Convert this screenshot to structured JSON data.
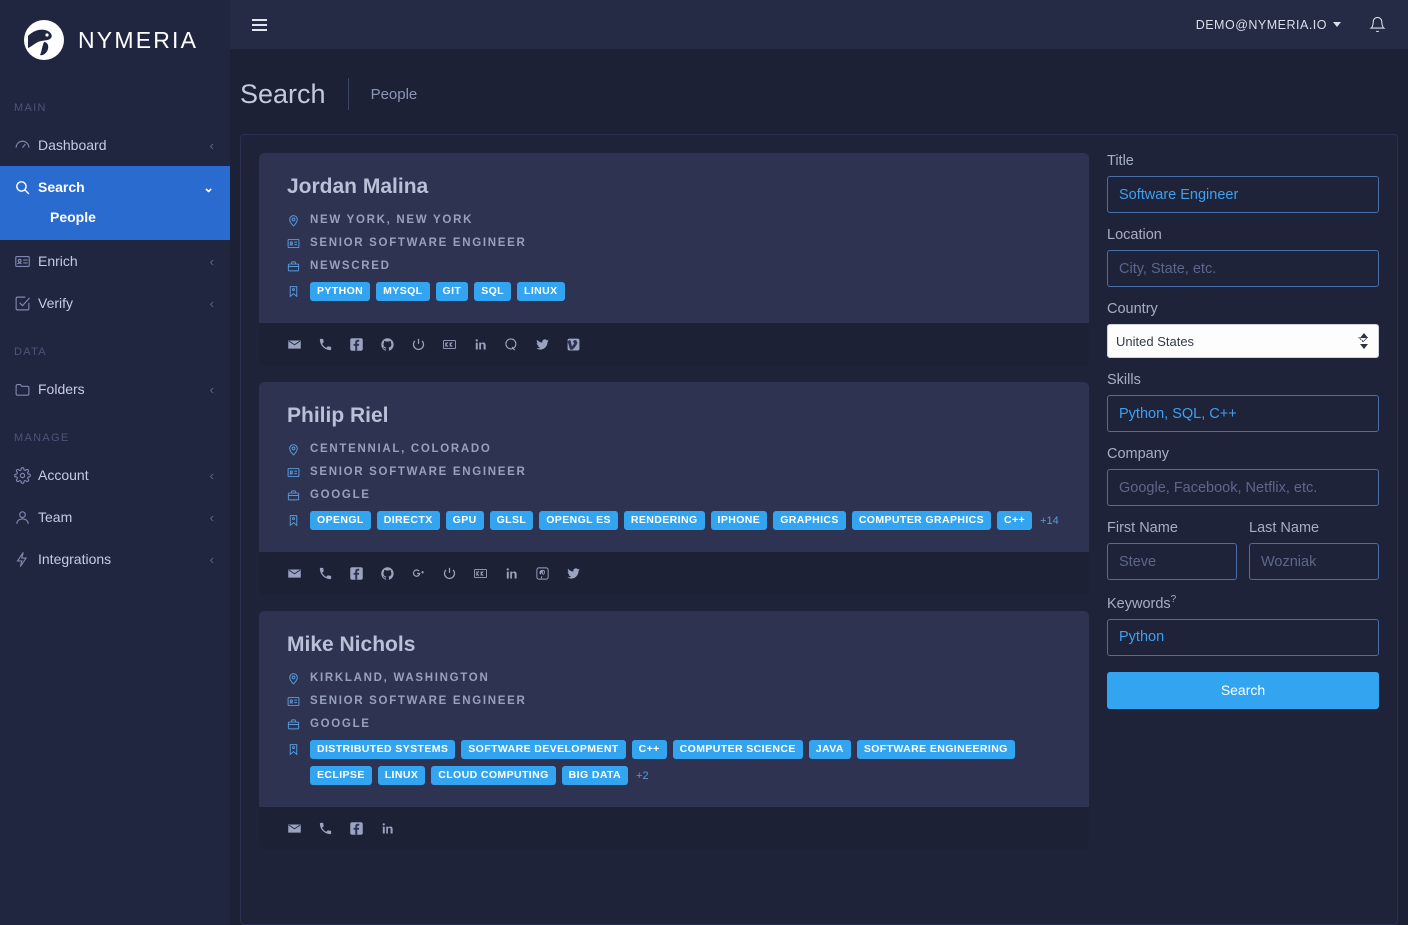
{
  "brand": {
    "name": "NYMERIA"
  },
  "topbar": {
    "user_email": "DEMO@NYMERIA.IO"
  },
  "sidebar": {
    "sections": [
      {
        "label": "MAIN"
      },
      {
        "label": "DATA"
      },
      {
        "label": "MANAGE"
      }
    ],
    "items": [
      {
        "label": "Dashboard",
        "icon": "dashboard-icon",
        "chevron": "‹"
      },
      {
        "label": "Search",
        "icon": "search-icon",
        "chevron": "⌄",
        "active": true,
        "sub": [
          {
            "label": "People"
          }
        ]
      },
      {
        "label": "Enrich",
        "icon": "id-card-icon",
        "chevron": "‹"
      },
      {
        "label": "Verify",
        "icon": "check-square-icon",
        "chevron": "‹"
      },
      {
        "label": "Folders",
        "icon": "folder-icon",
        "chevron": "‹"
      },
      {
        "label": "Account",
        "icon": "gear-icon",
        "chevron": "‹"
      },
      {
        "label": "Team",
        "icon": "user-icon",
        "chevron": "‹"
      },
      {
        "label": "Integrations",
        "icon": "plug-icon",
        "chevron": "‹"
      }
    ]
  },
  "page": {
    "title": "Search",
    "breadcrumb": "People"
  },
  "results": [
    {
      "name": "Jordan Malina",
      "location": "NEW YORK, NEW YORK",
      "title": "SENIOR SOFTWARE ENGINEER",
      "company": "NEWSCRED",
      "skills": [
        "PYTHON",
        "MYSQL",
        "GIT",
        "SQL",
        "LINUX"
      ],
      "skills_more": "",
      "socials": [
        "email-icon",
        "phone-icon",
        "facebook-icon",
        "github-icon",
        "wordpress-icon",
        "klout-icon",
        "linkedin-icon",
        "quora-icon",
        "twitter-icon",
        "vimeo-icon"
      ]
    },
    {
      "name": "Philip Riel",
      "location": "CENTENNIAL, COLORADO",
      "title": "SENIOR SOFTWARE ENGINEER",
      "company": "GOOGLE",
      "skills": [
        "OPENGL",
        "DIRECTX",
        "GPU",
        "GLSL",
        "OPENGL ES",
        "RENDERING",
        "IPHONE",
        "GRAPHICS",
        "COMPUTER GRAPHICS",
        "C++"
      ],
      "skills_more": "+14",
      "socials": [
        "email-icon",
        "phone-icon",
        "facebook-icon",
        "github-icon",
        "google-plus-icon",
        "wordpress-icon",
        "klout-icon",
        "linkedin-icon",
        "pinterest-icon",
        "twitter-icon"
      ]
    },
    {
      "name": "Mike Nichols",
      "location": "KIRKLAND, WASHINGTON",
      "title": "SENIOR SOFTWARE ENGINEER",
      "company": "GOOGLE",
      "skills": [
        "DISTRIBUTED SYSTEMS",
        "SOFTWARE DEVELOPMENT",
        "C++",
        "COMPUTER SCIENCE",
        "JAVA",
        "SOFTWARE ENGINEERING",
        "ECLIPSE",
        "LINUX",
        "CLOUD COMPUTING",
        "BIG DATA"
      ],
      "skills_more": "+2",
      "socials": [
        "email-icon",
        "phone-icon",
        "facebook-icon",
        "linkedin-icon"
      ]
    }
  ],
  "filters": {
    "title": {
      "label": "Title",
      "value": "Software Engineer",
      "placeholder": ""
    },
    "location": {
      "label": "Location",
      "value": "",
      "placeholder": "City, State, etc."
    },
    "country": {
      "label": "Country",
      "value": "United States",
      "options": [
        "United States"
      ]
    },
    "skills": {
      "label": "Skills",
      "value": "Python, SQL, C++",
      "placeholder": ""
    },
    "company": {
      "label": "Company",
      "value": "",
      "placeholder": "Google, Facebook, Netflix, etc."
    },
    "first_name": {
      "label": "First Name",
      "value": "",
      "placeholder": "Steve"
    },
    "last_name": {
      "label": "Last Name",
      "value": "",
      "placeholder": "Wozniak"
    },
    "keywords": {
      "label": "Keywords",
      "help": "?",
      "value": "Python",
      "placeholder": ""
    },
    "search_button": "Search"
  },
  "colors": {
    "accent": "#2a6bd0",
    "tag": "#33a5f0",
    "sidebar_bg": "#212640",
    "page_bg": "#1c2136",
    "card_bg": "#2d3350"
  }
}
